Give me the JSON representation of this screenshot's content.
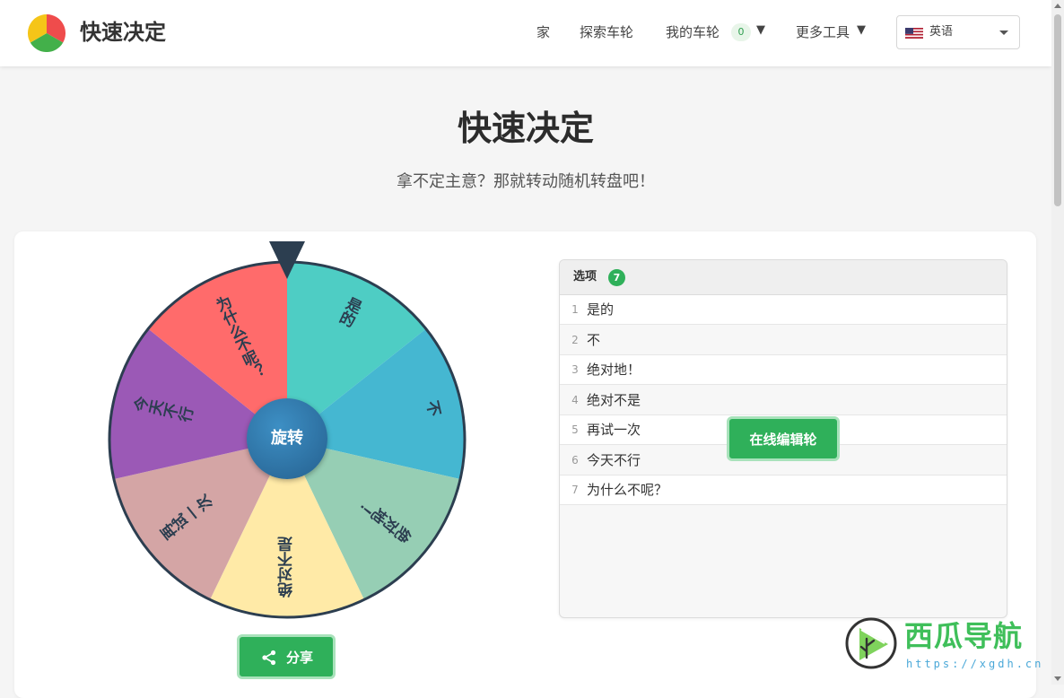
{
  "header": {
    "brand": "快速决定",
    "nav": {
      "home": "家",
      "explore": "探索车轮",
      "my_wheels": "我的车轮",
      "my_wheels_count": "0",
      "more_tools": "更多工具",
      "caret": "▼"
    },
    "language": "英语"
  },
  "hero": {
    "title": "快速决定",
    "subtitle": "拿不定主意？那就转动随机转盘吧！"
  },
  "wheel": {
    "segments": [
      {
        "label": "是的",
        "color": "#4ecdc4"
      },
      {
        "label": "不",
        "color": "#45b7d1"
      },
      {
        "label": "绝对地！",
        "color": "#96ceb4"
      },
      {
        "label": "绝对不是",
        "color": "#ffeaa7"
      },
      {
        "label": "再试一次",
        "color": "#d4a5a5"
      },
      {
        "label": "今天不行",
        "color": "#9b59b6"
      },
      {
        "label": "为什么不呢？",
        "color": "#ff6b6b"
      }
    ],
    "spin_label": "旋转",
    "pointer_color": "#2c3e50",
    "border_color": "#2c3e50"
  },
  "share_label": "分享",
  "options": {
    "title": "选项",
    "count": "7",
    "items": [
      {
        "num": "1",
        "text": "是的"
      },
      {
        "num": "2",
        "text": "不"
      },
      {
        "num": "3",
        "text": "绝对地！"
      },
      {
        "num": "4",
        "text": "绝对不是"
      },
      {
        "num": "5",
        "text": "再试一次"
      },
      {
        "num": "6",
        "text": "今天不行"
      },
      {
        "num": "7",
        "text": "为什么不呢？"
      }
    ]
  },
  "edit_label": "在线编辑轮",
  "watermark": {
    "title": "西瓜导航",
    "url": "https://xgdh.cn"
  },
  "colors": {
    "accent_green": "#2fb05a",
    "spin_blue": "#2e76a8"
  }
}
